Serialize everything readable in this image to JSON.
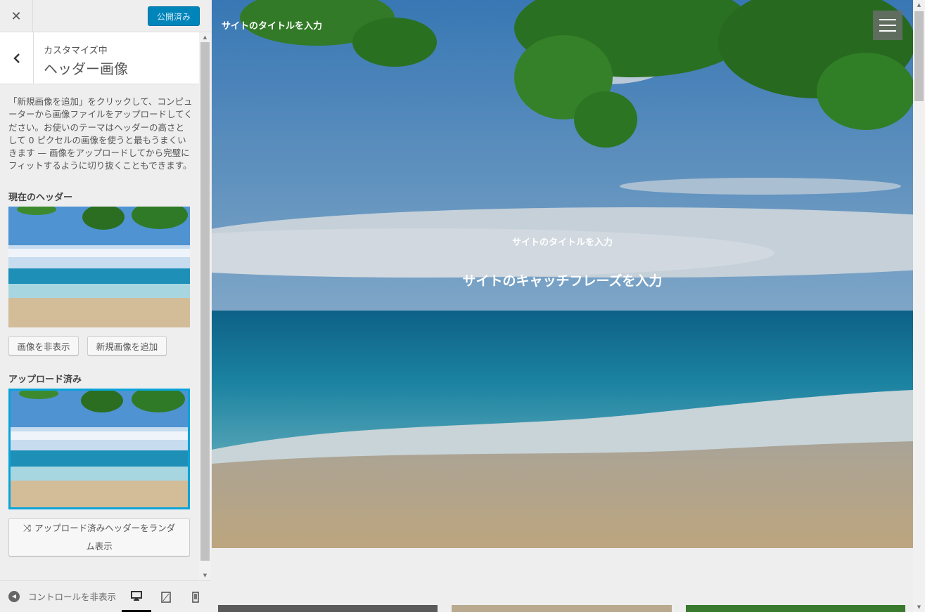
{
  "topbar": {
    "close_symbol": "✕",
    "publish_label": "公開済み"
  },
  "section": {
    "sub": "カスタマイズ中",
    "title": "ヘッダー画像"
  },
  "description": "「新規画像を追加」をクリックして、コンピューターから画像ファイルをアップロードしてください。お使いのテーマはヘッダーの高さとして 0 ピクセルの画像を使うと最もうまくいきます — 画像をアップロードしてから完璧にフィットするように切り抜くこともできます。",
  "current_header": {
    "label": "現在のヘッダー",
    "hide_label": "画像を非表示",
    "add_label": "新規画像を追加"
  },
  "uploaded": {
    "label": "アップロード済み",
    "random_label_line1": "アップロード済みヘッダーをランダ",
    "random_label_line2": "ム表示",
    "shuffle_symbol": "⤨"
  },
  "footer": {
    "collapse_label": "コントロールを非表示",
    "devices": [
      "desktop",
      "tablet",
      "mobile"
    ],
    "active_device": "desktop"
  },
  "preview": {
    "site_title_top": "サイトのタイトルを入力",
    "hero_title": "サイトのタイトルを入力",
    "hero_tagline": "サイトのキャッチフレーズを入力"
  },
  "colors": {
    "accent": "#0085ba",
    "selected_border": "#0aa3d9",
    "sidebar_bg": "#eeeeee"
  }
}
